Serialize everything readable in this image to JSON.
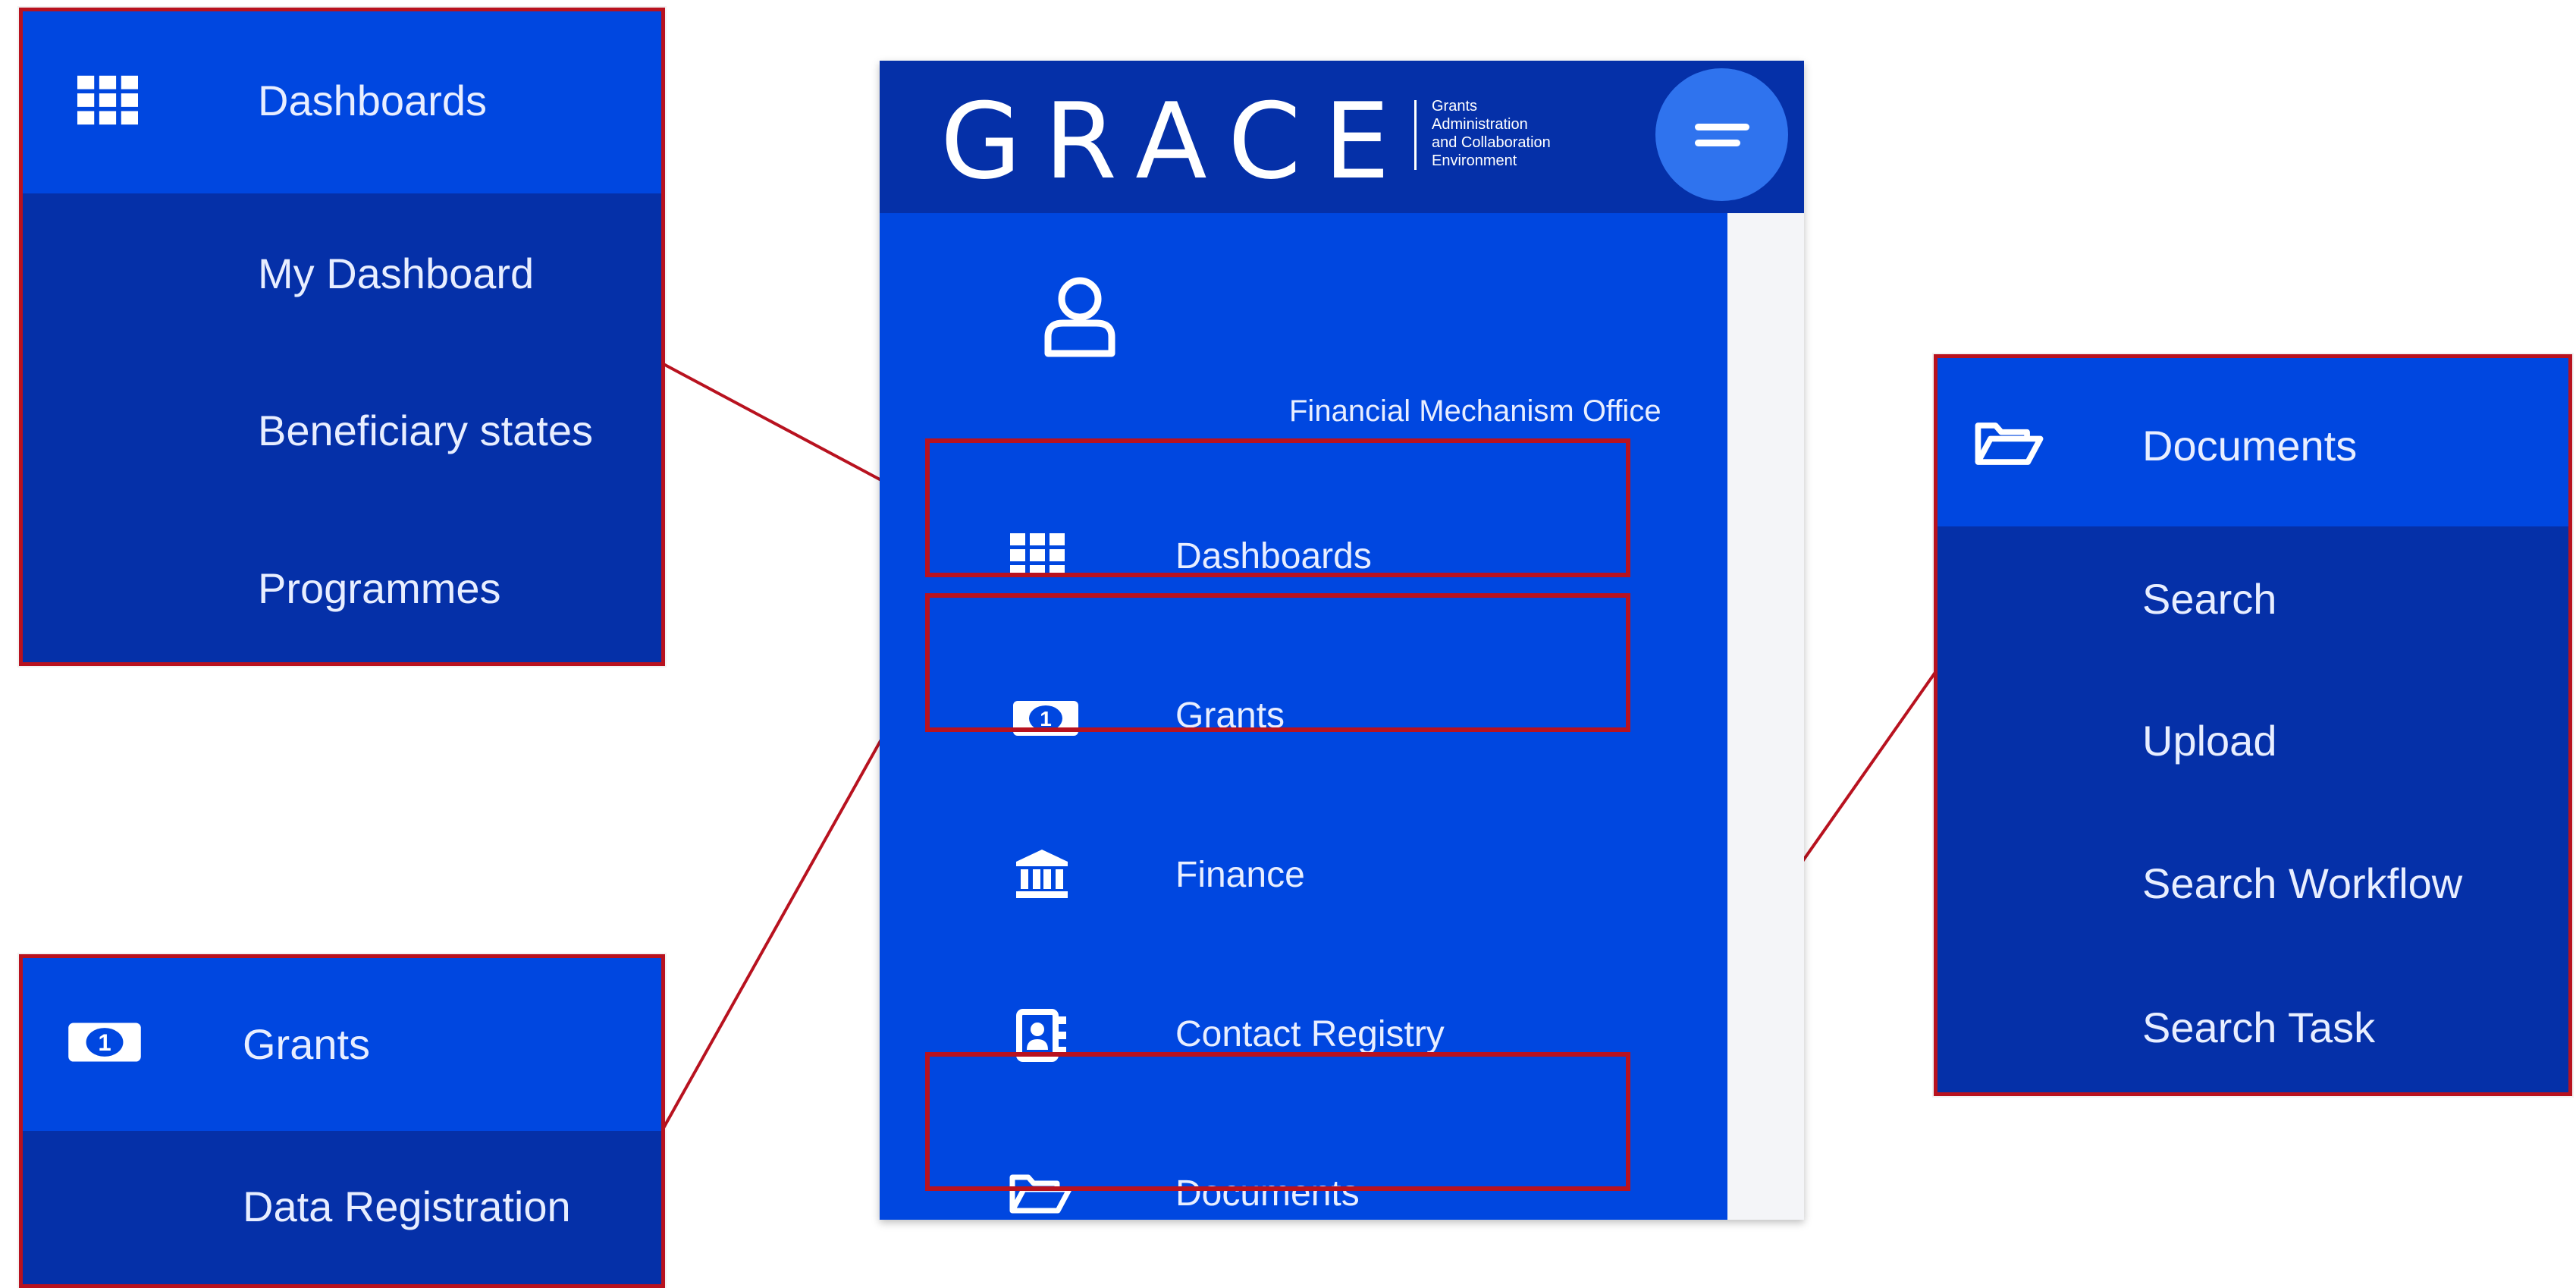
{
  "app": {
    "logo_text": "GRACE",
    "logo_tagline": [
      "Grants",
      "Administration",
      "and Collaboration",
      "Environment"
    ]
  },
  "user": {
    "org": "Financial Mechanism Office"
  },
  "nav": {
    "items": [
      {
        "label": "Dashboards",
        "icon": "grid-icon"
      },
      {
        "label": "Grants",
        "icon": "banknote-icon"
      },
      {
        "label": "Finance",
        "icon": "bank-icon"
      },
      {
        "label": "Contact Registry",
        "icon": "contact-book-icon"
      },
      {
        "label": "Documents",
        "icon": "folder-open-icon"
      }
    ]
  },
  "callouts": {
    "dashboards": {
      "title": "Dashboards",
      "items": [
        "My Dashboard",
        "Beneficiary states",
        "Programmes"
      ]
    },
    "grants": {
      "title": "Grants",
      "items": [
        "Data Registration"
      ]
    },
    "documents": {
      "title": "Documents",
      "items": [
        "Search",
        "Upload",
        "Search Workflow",
        "Search Task"
      ]
    }
  },
  "colors": {
    "sidebar_bg": "#0047e0",
    "header_bg": "#0530a8",
    "highlight_border": "#b8121f",
    "toggle_bg": "#2f73ee"
  }
}
